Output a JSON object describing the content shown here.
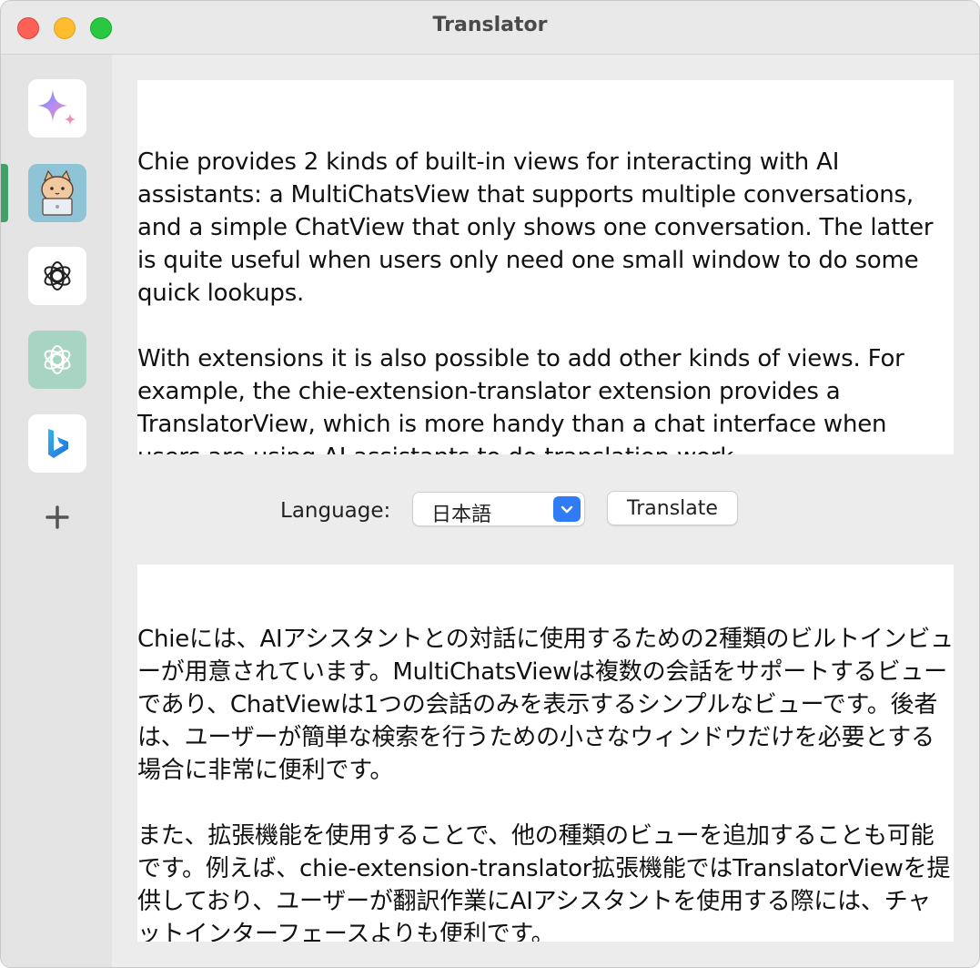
{
  "window": {
    "title": "Translator"
  },
  "sidebar": {
    "items": [
      {
        "name": "gemini",
        "icon": "sparkle-icon"
      },
      {
        "name": "cat-assistant",
        "icon": "cat-laptop-avatar-icon",
        "selected": true
      },
      {
        "name": "chatgpt",
        "icon": "openai-icon"
      },
      {
        "name": "chatgpt-green",
        "icon": "openai-icon"
      },
      {
        "name": "bing",
        "icon": "bing-icon"
      }
    ],
    "add_icon": "plus-icon",
    "accent_color": "#43a06a"
  },
  "source": {
    "text": "Chie provides 2 kinds of built-in views for interacting with AI assistants: a MultiChatsView that supports multiple conversations, and a simple ChatView that only shows one conversation. The latter is quite useful when users only need one small window to do some quick lookups.\n\nWith extensions it is also possible to add other kinds of views. For example, the chie-extension-translator extension provides a TranslatorView, which is more handy than a chat interface when users are using AI assistants to do translation work."
  },
  "controls": {
    "language_label": "Language:",
    "language_value": "日本語",
    "translate_label": "Translate",
    "select_accent": "#2f7cf6"
  },
  "output": {
    "text": "Chieには、AIアシスタントとの対話に使用するための2種類のビルトインビューが用意されています。MultiChatsViewは複数の会話をサポートするビューであり、ChatViewは1つの会話のみを表示するシンプルなビューです。後者は、ユーザーが簡単な検索を行うための小さなウィンドウだけを必要とする場合に非常に便利です。\n\nまた、拡張機能を使用することで、他の種類のビューを追加することも可能です。例えば、chie-extension-translator拡張機能ではTranslatorViewを提供しており、ユーザーが翻訳作業にAIアシスタントを使用する際には、チャットインターフェースよりも便利です。"
  }
}
